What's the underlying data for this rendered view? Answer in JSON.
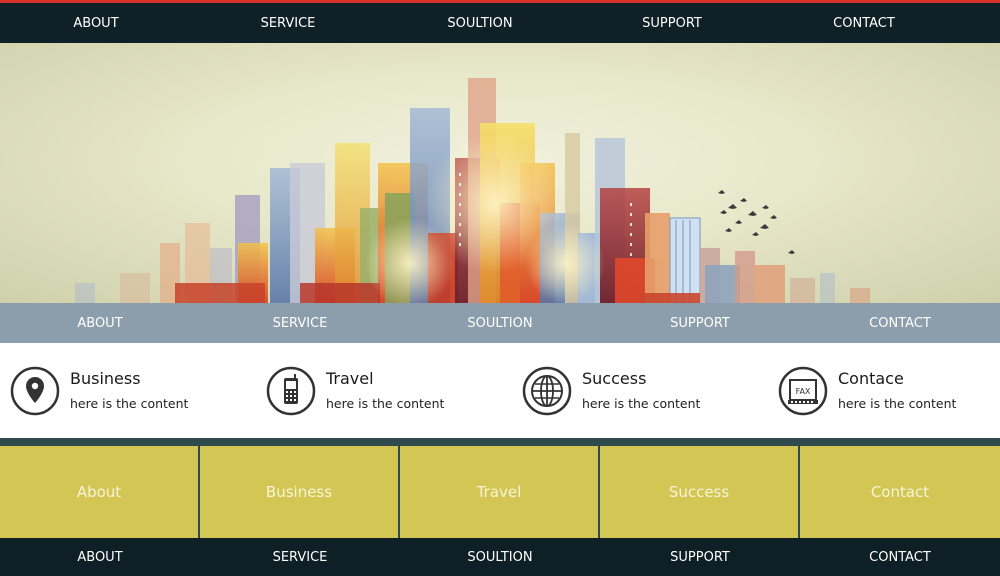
{
  "top_nav": [
    "ABOUT",
    "SERVICE",
    "SOULTION",
    "SUPPORT",
    "CONTACT"
  ],
  "sub_nav": [
    "ABOUT",
    "SERVICE",
    "SOULTION",
    "SUPPORT",
    "CONTACT"
  ],
  "features": [
    {
      "icon": "map-pin-icon",
      "title": "Business",
      "text": "here is the content"
    },
    {
      "icon": "mobile-phone-icon",
      "title": "Travel",
      "text": "here is the content"
    },
    {
      "icon": "globe-icon",
      "title": "Success",
      "text": "here is the content"
    },
    {
      "icon": "fax-icon",
      "title": "Contace",
      "text": "here is the content",
      "icon_label": "FAX"
    }
  ],
  "tiles": [
    "About",
    "Business",
    "Travel",
    "Success",
    "Contact"
  ],
  "footer_nav": [
    "ABOUT",
    "SERVICE",
    "SOULTION",
    "SUPPORT",
    "CONTACT"
  ],
  "colors": {
    "top_bar": "#102027",
    "top_accent": "#d6332e",
    "sub_nav": "#8c9eab",
    "tile": "#d3c654",
    "tile_border": "#2f4a4c",
    "footer": "#0f1f26"
  }
}
